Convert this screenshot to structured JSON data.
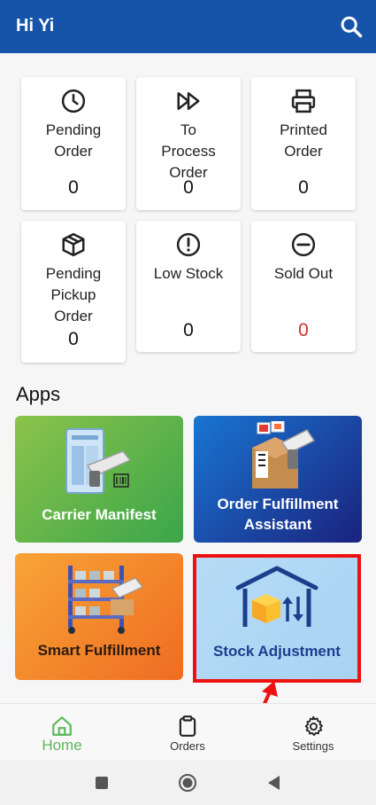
{
  "appbar": {
    "title": "Hi Yi",
    "search_icon": "search-icon"
  },
  "summary_cards": [
    {
      "label": "Pending Order",
      "value": "0",
      "icon": "clock-icon"
    },
    {
      "label": "To Process Order",
      "value": "0",
      "icon": "fast-forward-icon"
    },
    {
      "label": "Printed Order",
      "value": "0",
      "icon": "printer-icon"
    },
    {
      "label": "Pending Pickup Order",
      "value": "0",
      "icon": "package-icon"
    },
    {
      "label": "Low Stock",
      "value": "0",
      "icon": "alert-circle-icon"
    },
    {
      "label": "Sold Out",
      "value": "0",
      "icon": "minus-circle-icon",
      "value_color": "#d32f2f"
    }
  ],
  "apps": {
    "title": "Apps",
    "tiles": [
      {
        "label": "Carrier Manifest",
        "colors": [
          "#8bc34a",
          "#3aa64a"
        ]
      },
      {
        "label": "Order Fulfillment Assistant",
        "colors": [
          "#1976d2",
          "#1a237e"
        ]
      },
      {
        "label": "Smart Fulfillment",
        "colors": [
          "#f8a436",
          "#ef6c22"
        ]
      },
      {
        "label": "Stock Adjustment",
        "colors": [
          "#b6dcf7",
          "#a9d2f2"
        ]
      }
    ]
  },
  "bottom_nav": [
    {
      "label": "Home",
      "icon": "home-icon",
      "active": true
    },
    {
      "label": "Orders",
      "icon": "clipboard-icon",
      "active": false
    },
    {
      "label": "Settings",
      "icon": "gear-icon",
      "active": false
    }
  ],
  "colors": {
    "primary": "#1554a8",
    "active_nav": "#5cb85c",
    "highlight": "#ee1111"
  }
}
